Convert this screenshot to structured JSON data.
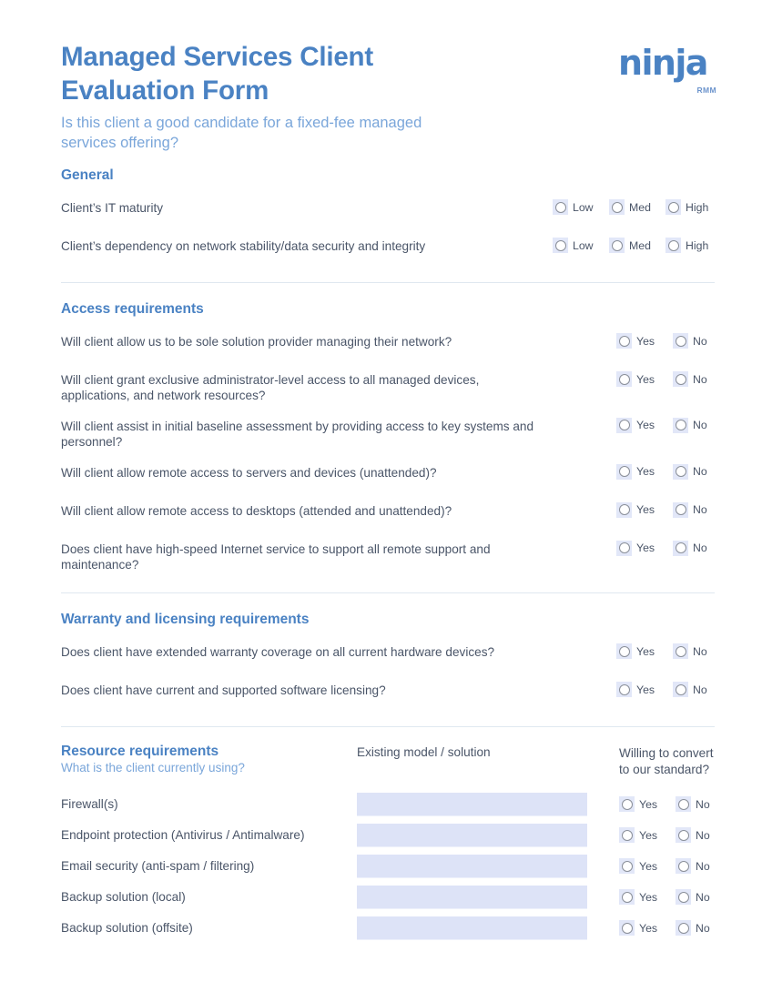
{
  "brand": {
    "logo_word": "ninja",
    "logo_sub": "RMM",
    "accent": "#4a82c3",
    "accent_light": "#7aa6da",
    "field_fill": "#dde3f7",
    "radio_fill": "#e2e7f8",
    "text": "#4a5568",
    "divider": "#dfe8f0"
  },
  "header": {
    "title": "Managed Services Client Evaluation Form",
    "subtitle": "Is this client a good candidate for a fixed-fee managed services offering?"
  },
  "general": {
    "heading": "General",
    "options": [
      "Low",
      "Med",
      "High"
    ],
    "questions": [
      "Client’s IT maturity",
      "Client’s dependency on network stability/data security and integrity"
    ]
  },
  "access": {
    "heading": "Access requirements",
    "options": [
      "Yes",
      "No"
    ],
    "questions": [
      "Will client allow us to be sole solution provider managing their network?",
      "Will client grant exclusive administrator-level access to all managed devices, applications, and network resources?",
      "Will client assist in initial baseline assessment by providing access to key systems and personnel?",
      "Will client allow remote access to servers and devices (unattended)?",
      "Will client allow remote access to desktops (attended and unattended)?",
      "Does client have high-speed Internet service to support all remote support and maintenance?"
    ]
  },
  "warranty": {
    "heading": "Warranty and licensing requirements",
    "options": [
      "Yes",
      "No"
    ],
    "questions": [
      "Does client have extended warranty coverage on all current hardware devices?",
      "Does client have current and supported software licensing?"
    ]
  },
  "resources": {
    "heading": "Resource requirements",
    "subheading": "What is the client currently using?",
    "col_model": "Existing model / solution",
    "col_convert": "Willing to convert to our standard?",
    "options": [
      "Yes",
      "No"
    ],
    "input_placeholder": "",
    "rows": [
      {
        "label": "Firewall(s)",
        "value": ""
      },
      {
        "label": "Endpoint protection (Antivirus / Antimalware)",
        "value": ""
      },
      {
        "label": "Email security (anti-spam / filtering)",
        "value": ""
      },
      {
        "label": "Backup solution (local)",
        "value": ""
      },
      {
        "label": "Backup solution (offsite)",
        "value": ""
      }
    ]
  }
}
